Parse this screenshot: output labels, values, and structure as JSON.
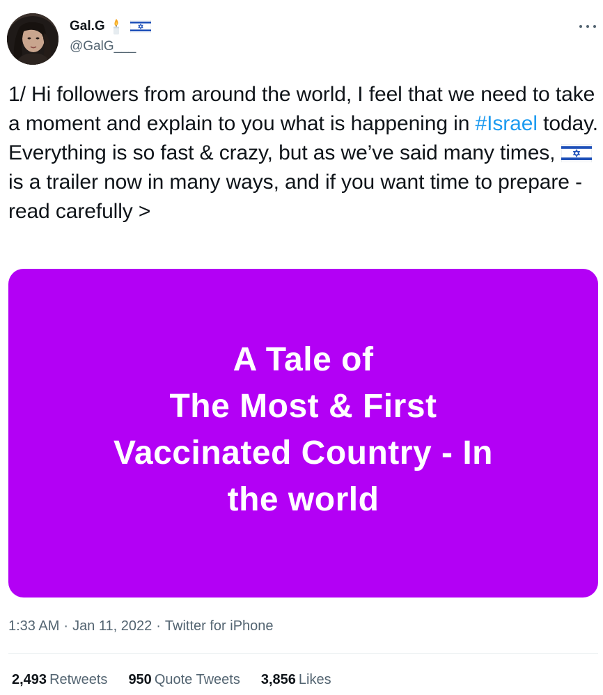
{
  "author": {
    "display_name": "Gal.G",
    "handle": "@GalG___",
    "badges": [
      "candle-icon",
      "israel-flag-icon"
    ]
  },
  "more_menu": {
    "icon": "more-horizontal-icon"
  },
  "tweet": {
    "text_before_hashtag": "1/ Hi followers from around the world, I feel that we need to take a moment and explain to you what is happening in ",
    "hashtag": "#Israel",
    "text_after_hashtag": " today.  Everything is so fast & crazy, but as we’ve said many times, ",
    "inline_emoji": "israel-flag-icon",
    "text_after_emoji": " is a trailer now in many ways, and if you want time to prepare - read carefully >"
  },
  "media": {
    "background_color": "#b300f5",
    "lines": [
      "A Tale of",
      "The Most & First",
      "Vaccinated Country - In",
      "the world"
    ]
  },
  "meta": {
    "time": "1:33 AM",
    "separator": "·",
    "date": "Jan 11, 2022",
    "source": "Twitter for iPhone"
  },
  "stats": {
    "retweets": {
      "count": "2,493",
      "label": "Retweets"
    },
    "quote_tweets": {
      "count": "950",
      "label": "Quote Tweets"
    },
    "likes": {
      "count": "3,856",
      "label": "Likes"
    }
  },
  "colors": {
    "text": "#0f1419",
    "secondary": "#536471",
    "link": "#1d9bf0",
    "media_bg": "#b300f5"
  }
}
